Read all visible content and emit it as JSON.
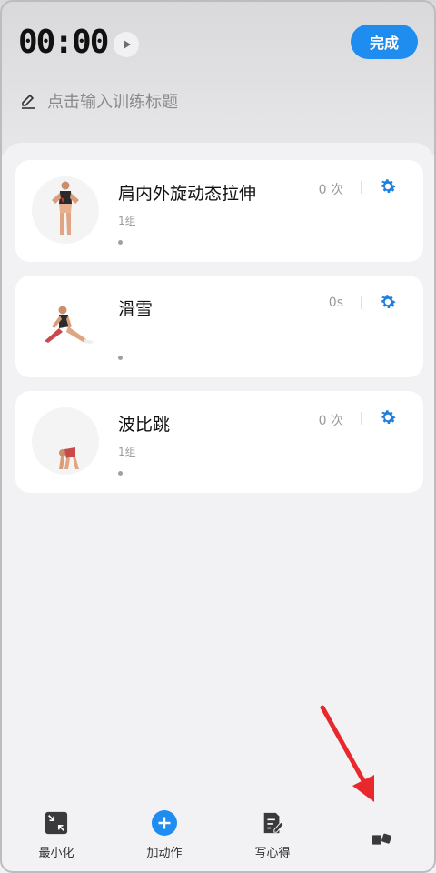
{
  "header": {
    "timer": "00:00",
    "done_label": "完成",
    "title_placeholder": "点击输入训练标题"
  },
  "exercises": [
    {
      "name": "肩内外旋动态拉伸",
      "sets": "1组",
      "count": "0 次",
      "thumb_icon": "shoulder-rotation-figure"
    },
    {
      "name": "滑雪",
      "sets": "",
      "count": "0s",
      "thumb_icon": "skier-lunge-figure"
    },
    {
      "name": "波比跳",
      "sets": "1组",
      "count": "0 次",
      "thumb_icon": "burpee-figure"
    }
  ],
  "bottom_nav": {
    "items": [
      {
        "label": "最小化",
        "icon": "minimize-icon"
      },
      {
        "label": "加动作",
        "icon": "add-icon"
      },
      {
        "label": "写心得",
        "icon": "note-edit-icon"
      },
      {
        "label": "",
        "icon": "more-icon"
      }
    ]
  },
  "colors": {
    "accent": "#1f8cf0",
    "arrow": "#e8282b"
  }
}
